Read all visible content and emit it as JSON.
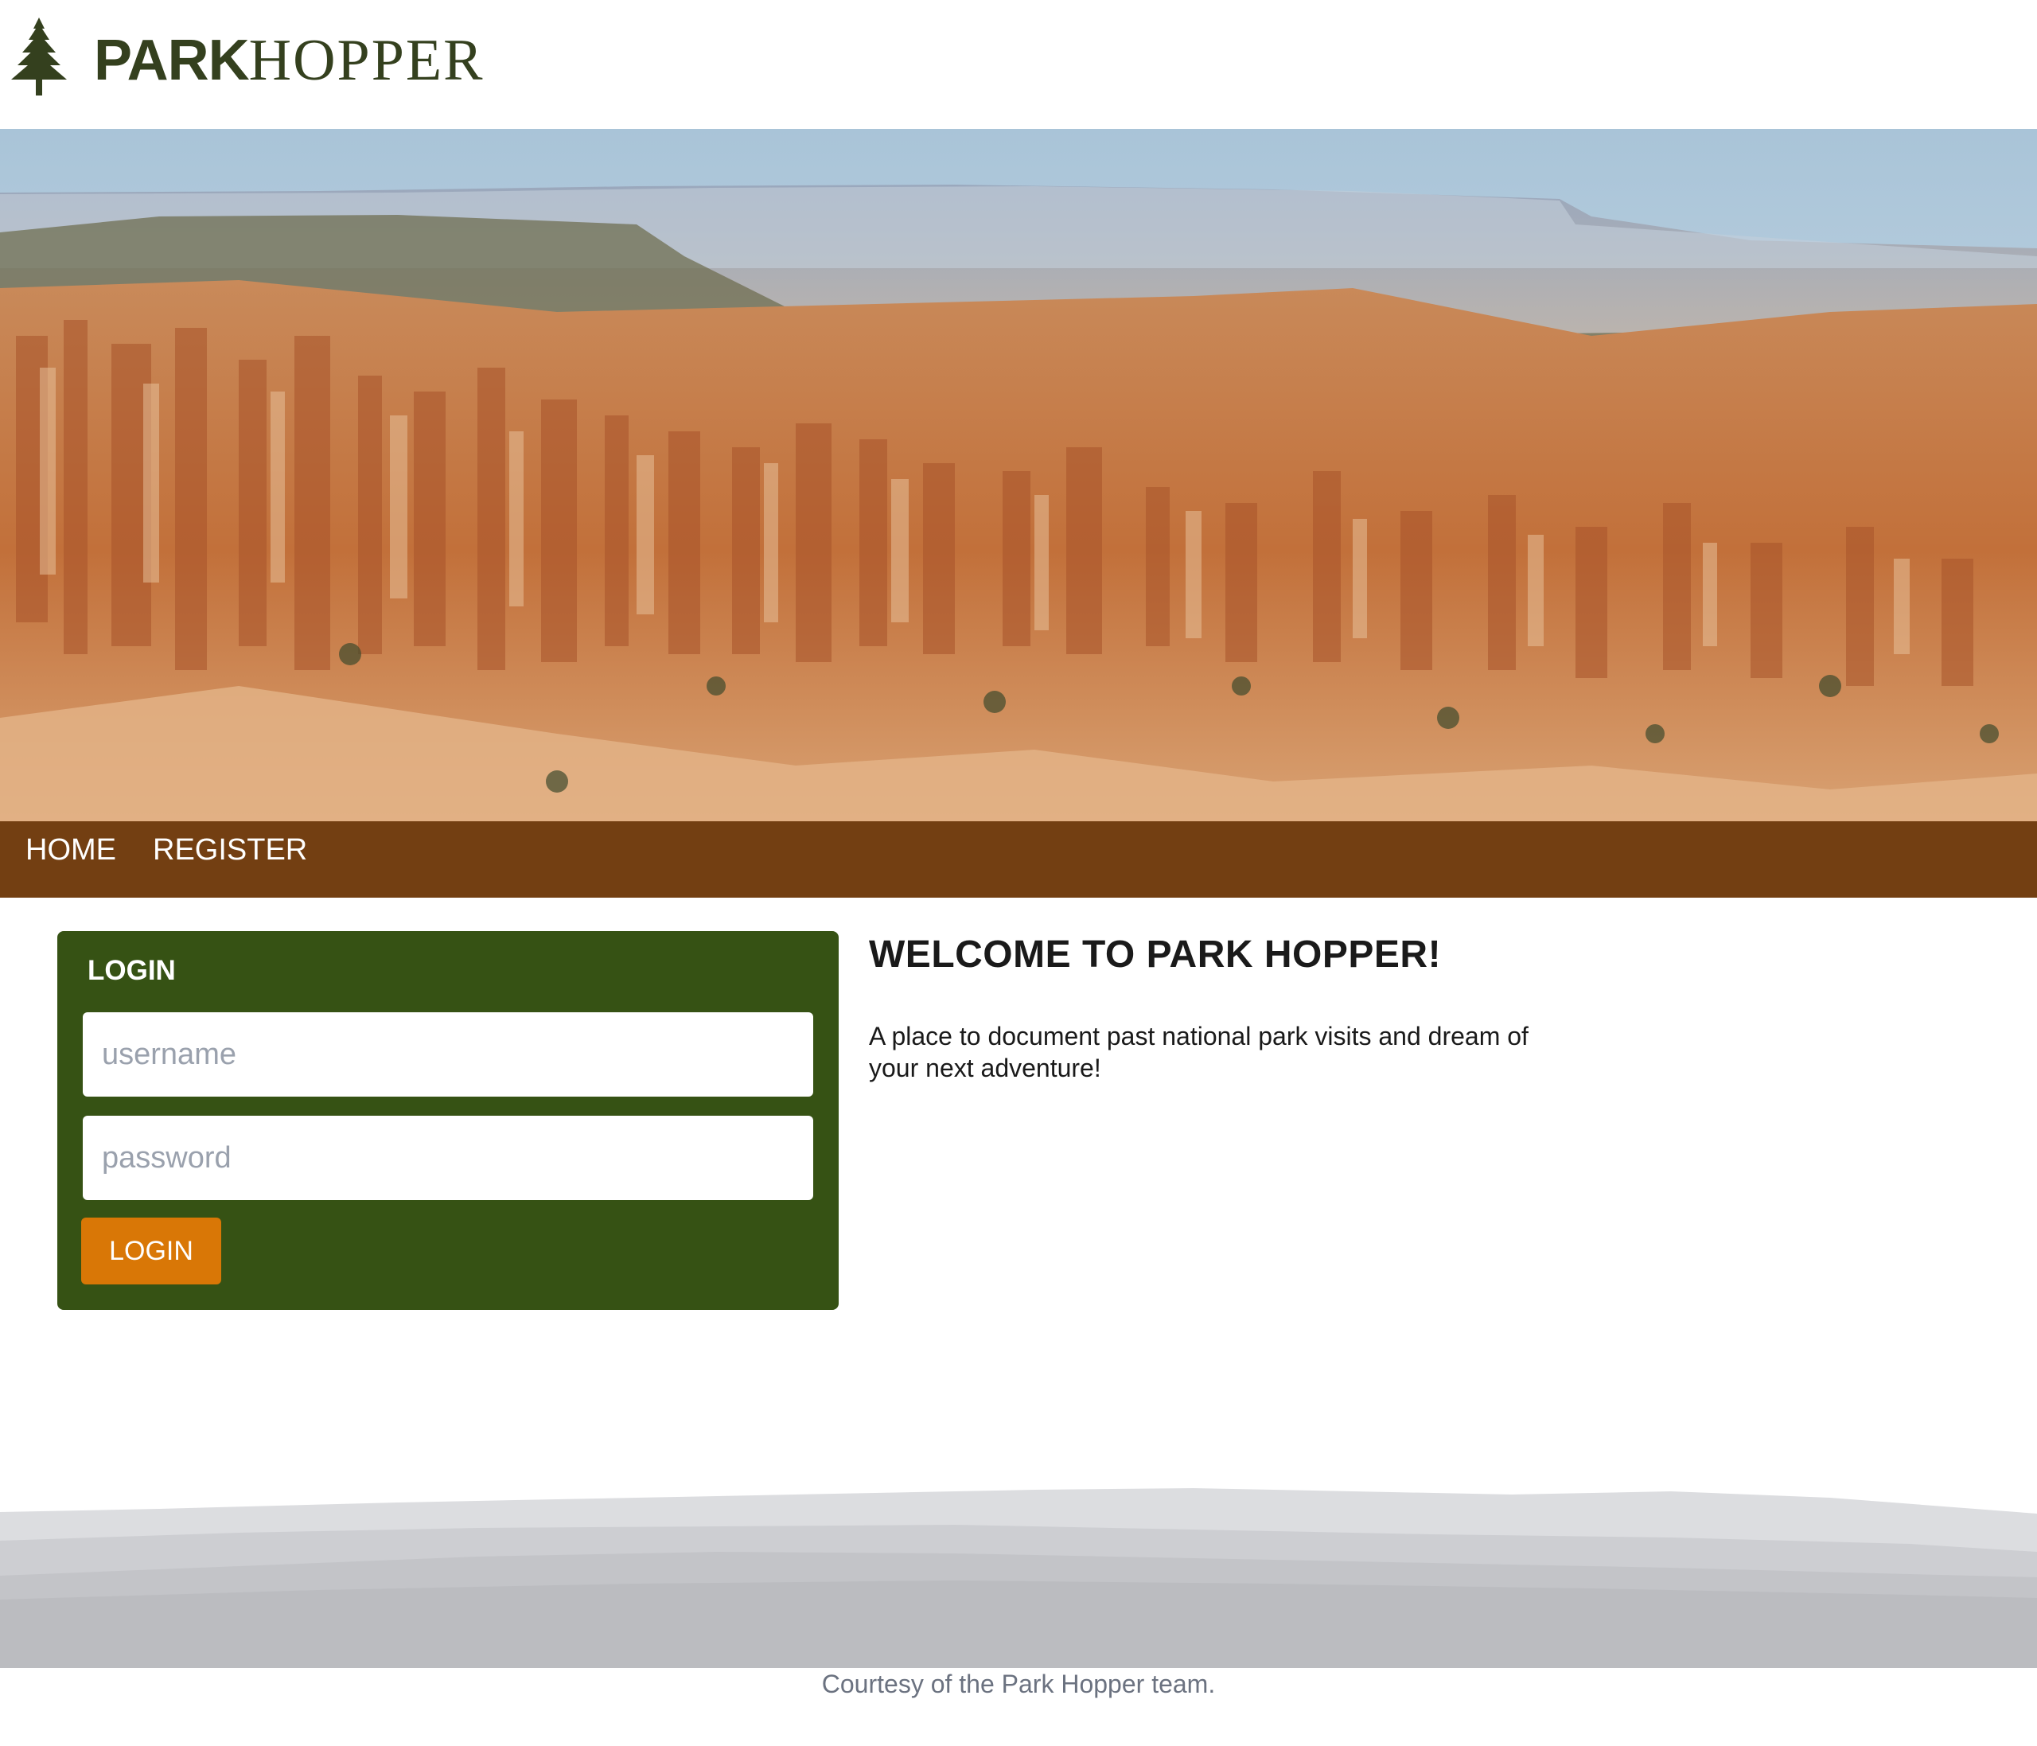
{
  "brand": {
    "logo_icon": "pine-tree-icon",
    "name_part1": "PARK",
    "name_part2": "HOPPER"
  },
  "hero": {
    "image": "canyon-hoodoos-landscape"
  },
  "nav": {
    "items": [
      {
        "label": "HOME"
      },
      {
        "label": "REGISTER"
      }
    ]
  },
  "login": {
    "title": "LOGIN",
    "username_placeholder": "username",
    "password_placeholder": "password",
    "button_label": "LOGIN"
  },
  "welcome": {
    "title": "WELCOME TO PARK HOPPER!",
    "text": "A place to document past national park visits and dream of your next adventure!"
  },
  "footer": {
    "credit": "Courtesy of the Park Hopper team."
  },
  "colors": {
    "nav_bg": "#733f12",
    "login_bg": "#365214",
    "button_bg": "#d97706",
    "logo": "#34401e"
  }
}
